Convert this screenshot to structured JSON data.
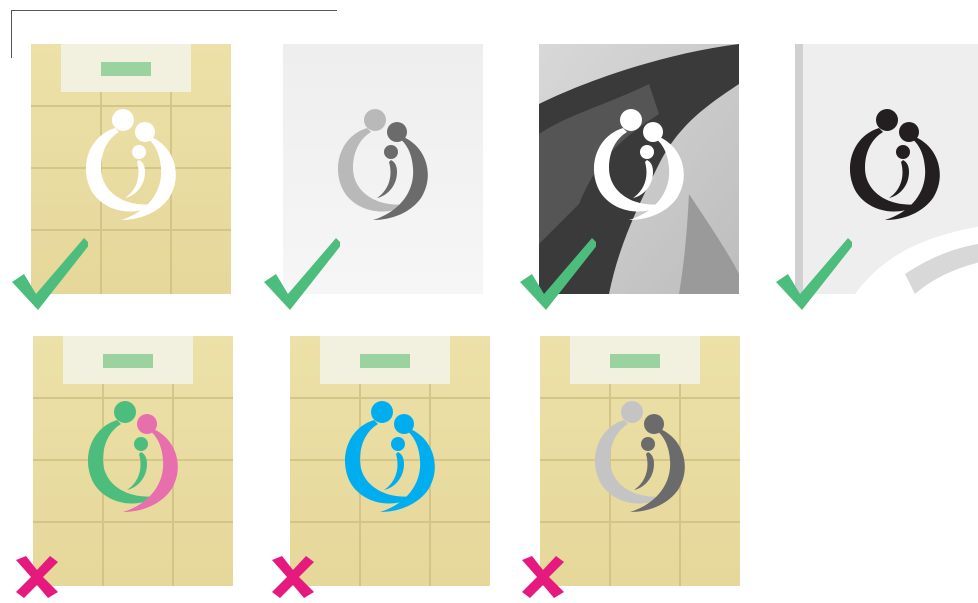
{
  "colors": {
    "approved_mark": "#4dbd7d",
    "rejected_mark": "#e5197e"
  },
  "approved_examples": [
    {
      "background": "tiled-wall",
      "logo": "white-logo",
      "verdict": "approved"
    },
    {
      "background": "light-gray",
      "logo": "gray-logo",
      "verdict": "approved"
    },
    {
      "background": "monochrome-photo-arm",
      "logo": "white-logo",
      "verdict": "approved"
    },
    {
      "background": "monochrome-photo-light",
      "logo": "black-logo",
      "verdict": "approved"
    }
  ],
  "rejected_examples": [
    {
      "background": "tiled-wall",
      "logo": "green-pink-logo",
      "verdict": "rejected"
    },
    {
      "background": "tiled-wall",
      "logo": "blue-logo",
      "verdict": "rejected"
    },
    {
      "background": "tiled-wall",
      "logo": "gray-logo",
      "verdict": "rejected"
    }
  ],
  "icons": {
    "approved": "checkmark-icon",
    "rejected": "x-mark-icon"
  }
}
